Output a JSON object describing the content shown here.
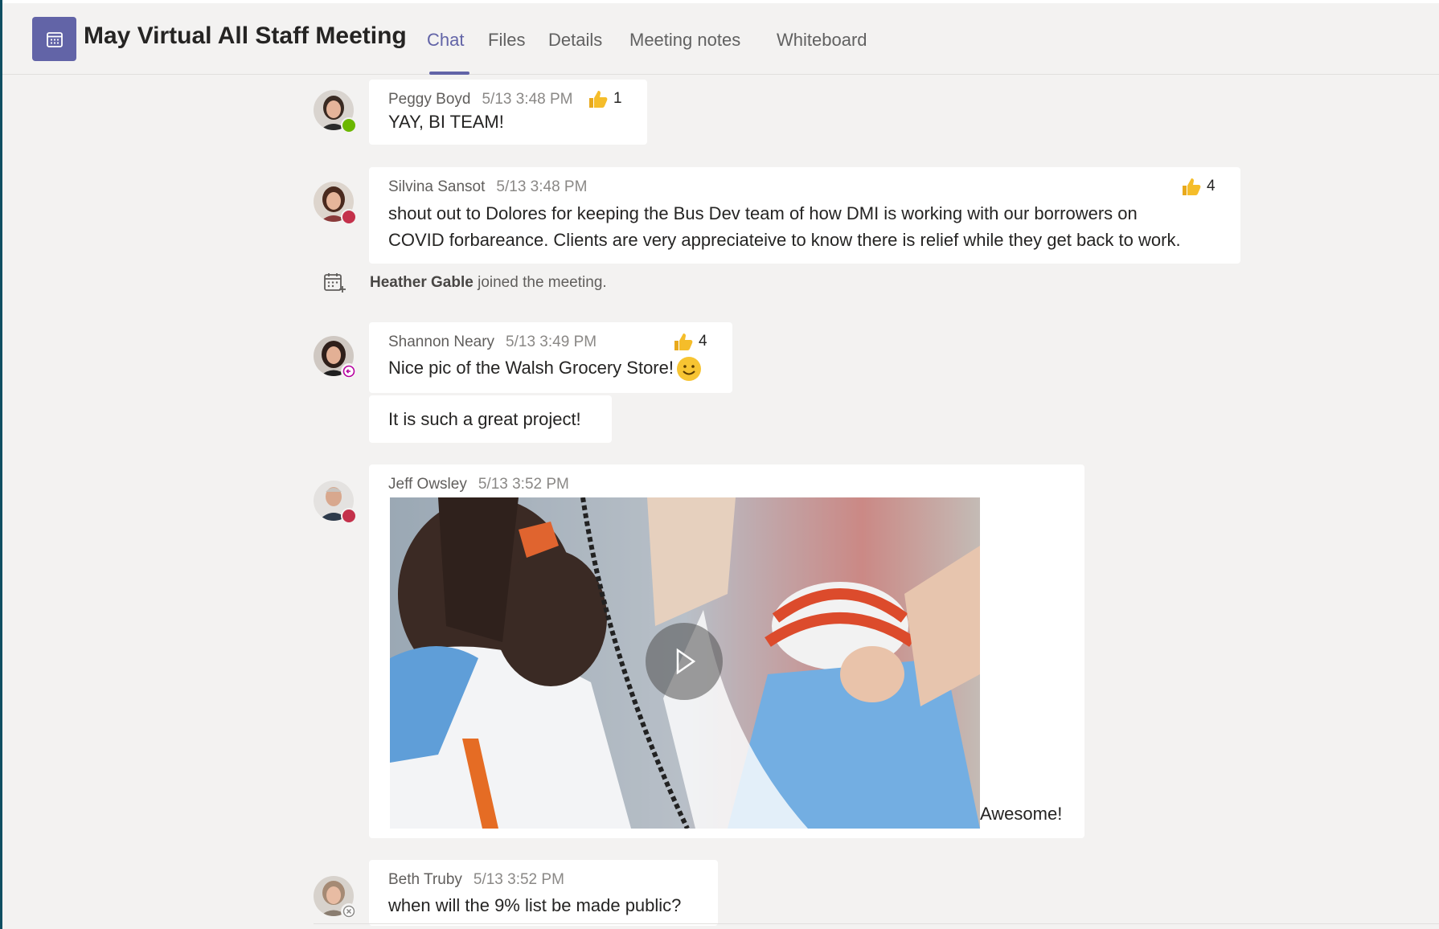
{
  "meeting": {
    "title": "May Virtual All Staff Meeting",
    "tabs": [
      {
        "label": "Chat",
        "active": true
      },
      {
        "label": "Files",
        "active": false
      },
      {
        "label": "Details",
        "active": false
      },
      {
        "label": "Meeting notes",
        "active": false
      },
      {
        "label": "Whiteboard",
        "active": false
      }
    ],
    "icon": "calendar-icon",
    "accent": "#6264a7"
  },
  "messages": [
    {
      "author": "Peggy Boyd",
      "time": "5/13 3:48 PM",
      "reaction": {
        "icon": "thumbs-up-icon",
        "count": "1"
      },
      "lines": [
        "YAY, BI TEAM!"
      ],
      "presence": "available",
      "presence_color": "#6bb700"
    },
    {
      "author": "Silvina Sansot",
      "time": "5/13 3:48 PM",
      "reaction": {
        "icon": "thumbs-up-icon",
        "count": "4"
      },
      "lines": [
        "shout out to Dolores for keeping the Bus Dev team of how DMI is working with our borrowers on",
        "COVID forbareance. Clients are very appreciateive to know there is relief while they get back to work."
      ],
      "presence": "busy",
      "presence_color": "#c4314b"
    },
    {
      "author": "Shannon Neary",
      "time": "5/13 3:49 PM",
      "reaction": {
        "icon": "thumbs-up-icon",
        "count": "4"
      },
      "lines": [
        "Nice pic of the Walsh Grocery Store!"
      ],
      "emoji": "smile-emoji-icon",
      "followup": "It is such a great project!",
      "presence": "away-return",
      "presence_color": "#b4009e"
    },
    {
      "author": "Jeff Owsley",
      "time": "5/13 3:52 PM",
      "attachment": "video",
      "caption": "Awesome!",
      "presence": "busy",
      "presence_color": "#c4314b"
    },
    {
      "author": "Beth Truby",
      "time": "5/13 3:52 PM",
      "lines": [
        "when will the 9% list be made public?"
      ],
      "presence": "offline",
      "presence_color": "#8a8886"
    }
  ],
  "system_event": {
    "name": "Heather Gable",
    "text": "joined the meeting.",
    "icon": "calendar-join-icon"
  }
}
